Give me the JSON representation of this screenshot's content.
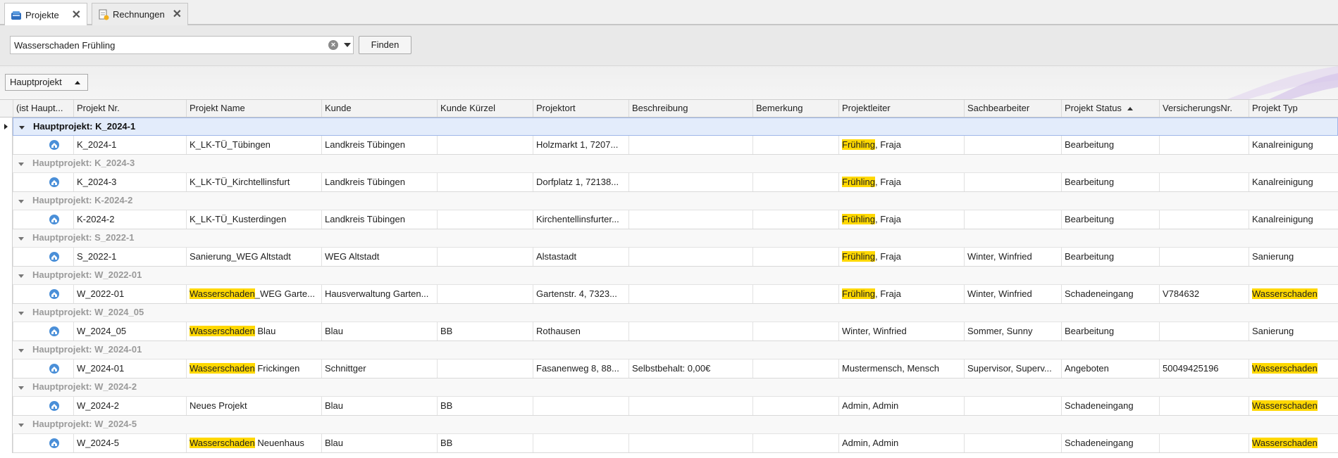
{
  "tabs": [
    {
      "label": "Projekte",
      "active": true,
      "icon": "project-box-icon"
    },
    {
      "label": "Rechnungen",
      "active": false,
      "icon": "invoice-icon"
    }
  ],
  "search": {
    "value": "Wasserschaden Frühling",
    "find_label": "Finden",
    "highlight_terms": [
      "Wasserschaden",
      "Frühling"
    ]
  },
  "group_chip": {
    "label": "Hauptprojekt",
    "sort": "ascending"
  },
  "columns": [
    "(ist Haupt...",
    "Projekt Nr.",
    "Projekt Name",
    "Kunde",
    "Kunde Kürzel",
    "Projektort",
    "Beschreibung",
    "Bemerkung",
    "Projektleiter",
    "Sachbearbeiter",
    "Projekt Status",
    "VersicherungsNr.",
    "Projekt Typ"
  ],
  "sorted_column": "Projekt Status",
  "groups": [
    {
      "label": "Hauptprojekt: K_2024-1",
      "selected": true,
      "row": [
        "K_2024-1",
        "K_LK-TÜ_Tübingen",
        "Landkreis Tübingen",
        "",
        "Holzmarkt 1, 7207...",
        "",
        "",
        "Frühling, Fraja",
        "",
        "Bearbeitung",
        "",
        "Kanalreinigung"
      ]
    },
    {
      "label": "Hauptprojekt: K_2024-3",
      "selected": false,
      "row": [
        "K_2024-3",
        "K_LK-TÜ_Kirchtellinsfurt",
        "Landkreis Tübingen",
        "",
        "Dorfplatz 1, 72138...",
        "",
        "",
        "Frühling, Fraja",
        "",
        "Bearbeitung",
        "",
        "Kanalreinigung"
      ]
    },
    {
      "label": "Hauptprojekt: K-2024-2",
      "selected": false,
      "row": [
        "K-2024-2",
        "K_LK-TÜ_Kusterdingen",
        "Landkreis Tübingen",
        "",
        "Kirchentellinsfurter...",
        "",
        "",
        "Frühling, Fraja",
        "",
        "Bearbeitung",
        "",
        "Kanalreinigung"
      ]
    },
    {
      "label": "Hauptprojekt: S_2022-1",
      "selected": false,
      "row": [
        "S_2022-1",
        "Sanierung_WEG Altstadt",
        "WEG Altstadt",
        "",
        "Alstastadt",
        "",
        "",
        "Frühling, Fraja",
        "Winter, Winfried",
        "Bearbeitung",
        "",
        "Sanierung"
      ]
    },
    {
      "label": "Hauptprojekt: W_2022-01",
      "selected": false,
      "row": [
        "W_2022-01",
        "Wasserschaden_WEG Garte...",
        "Hausverwaltung Garten...",
        "",
        "Gartenstr. 4, 7323...",
        "",
        "",
        "Frühling, Fraja",
        "Winter, Winfried",
        "Schadeneingang",
        "V784632",
        "Wasserschaden"
      ]
    },
    {
      "label": "Hauptprojekt: W_2024_05",
      "selected": false,
      "row": [
        "W_2024_05",
        "Wasserschaden Blau",
        "Blau",
        "BB",
        "Rothausen",
        "",
        "",
        "Winter, Winfried",
        "Sommer, Sunny",
        "Bearbeitung",
        "",
        "Sanierung"
      ]
    },
    {
      "label": "Hauptprojekt: W_2024-01",
      "selected": false,
      "row": [
        "W_2024-01",
        "Wasserschaden Frickingen",
        "Schnittger",
        "",
        "Fasanenweg 8, 88...",
        "Selbstbehalt: 0,00€",
        "",
        "Mustermensch, Mensch",
        "Supervisor, Superv...",
        "Angeboten",
        "50049425196",
        "Wasserschaden"
      ]
    },
    {
      "label": "Hauptprojekt: W_2024-2",
      "selected": false,
      "row": [
        "W_2024-2",
        "Neues Projekt",
        "Blau",
        "BB",
        "",
        "",
        "",
        "Admin, Admin",
        "",
        "Schadeneingang",
        "",
        "Wasserschaden"
      ]
    },
    {
      "label": "Hauptprojekt: W_2024-5",
      "selected": false,
      "row": [
        "W_2024-5",
        "Wasserschaden Neuenhaus",
        "Blau",
        "BB",
        "",
        "",
        "",
        "Admin, Admin",
        "",
        "Schadeneingang",
        "",
        "Wasserschaden"
      ]
    }
  ],
  "colors": {
    "highlight": "#ffd800",
    "selection": "#e3ecfb",
    "accent": "#3a7bd5"
  }
}
